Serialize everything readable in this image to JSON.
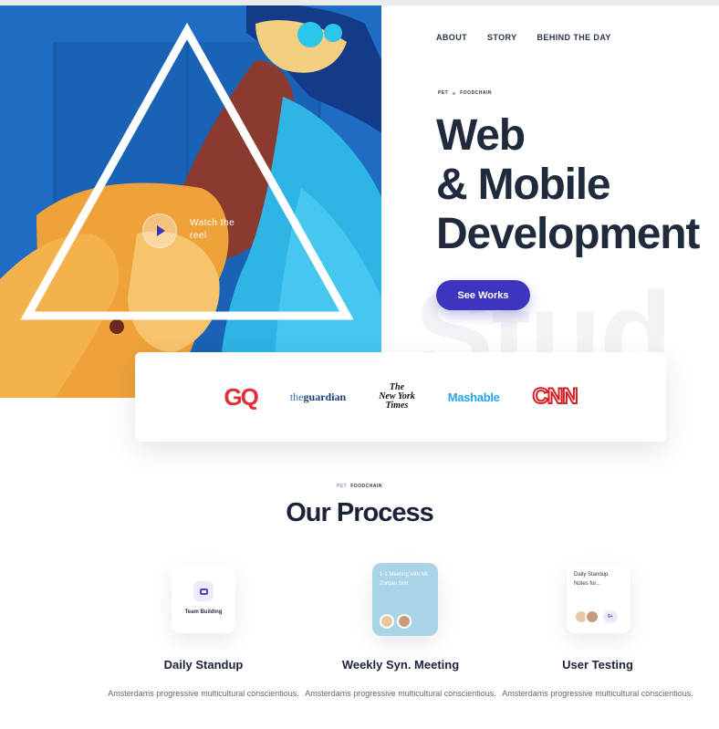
{
  "hero": {
    "watch_label": "Watch the reel"
  },
  "nav": {
    "items": [
      "ABOUT",
      "STORY",
      "BEHIND THE DAY"
    ]
  },
  "eyebrow": {
    "left": "PET",
    "right": "FOODCHAIN"
  },
  "headline": {
    "line1": "Web",
    "line2": "& Mobile",
    "line3": "Development"
  },
  "watermark": "Stud",
  "cta": {
    "label": "See Works",
    "color": "#3d35bd"
  },
  "logos": {
    "gq": "GQ",
    "guardian_prefix": "the",
    "guardian_name": "guardian",
    "nyt_line1": "The",
    "nyt_line2": "New York",
    "nyt_line3": "Times",
    "mashable": "Mashable",
    "cnn": "CNN"
  },
  "process": {
    "eyebrow_left": "PET",
    "eyebrow_right": "FOODCHAIN",
    "title": "Our Process",
    "cards": {
      "card1_label": "Team Building",
      "card2_text": "1-1 Meeting with Mr. Zordan Smt",
      "card3_text": "Daily Standup Notes for...",
      "card3_more": "6+"
    },
    "steps": [
      {
        "title": "Daily Standup",
        "desc": "Amsterdams progressive multicultural conscientious."
      },
      {
        "title": "Weekly Syn. Meeting",
        "desc": "Amsterdams progressive multicultural conscientious."
      },
      {
        "title": "User Testing",
        "desc": "Amsterdams progressive multicultural conscientious."
      }
    ]
  }
}
